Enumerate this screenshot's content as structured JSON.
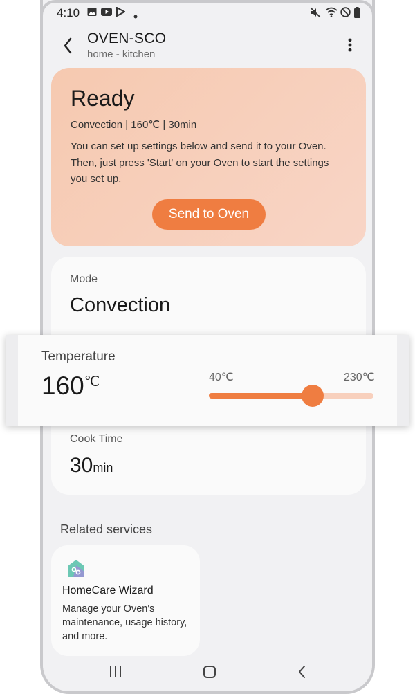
{
  "statusbar": {
    "time": "4:10",
    "left_icons": [
      "image-icon",
      "youtube-icon",
      "play-store-icon",
      "dot-icon"
    ],
    "right_icons": [
      "mute-icon",
      "wifi-icon",
      "do-not-disturb-icon",
      "battery-icon"
    ]
  },
  "header": {
    "title": "OVEN-SCO",
    "subtitle": "home - kitchen"
  },
  "status_card": {
    "title": "Ready",
    "summary": "Convection | 160℃ | 30min",
    "description": "You can set up settings below and send it to your Oven. Then, just press 'Start' on your Oven to start the settings you set up.",
    "send_button": "Send to Oven"
  },
  "settings": {
    "mode_label": "Mode",
    "mode_value": "Convection",
    "temperature_label": "Temperature",
    "temperature_value": "160",
    "temperature_unit": "℃",
    "temp_min": "40℃",
    "temp_max": "230℃",
    "temp_slider_fraction": 0.63,
    "cook_time_label": "Cook Time",
    "cook_time_value": "30",
    "cook_time_unit": "min"
  },
  "related": {
    "title": "Related services",
    "services": [
      {
        "name": "HomeCare Wizard",
        "description": "Manage your Oven's maintenance, usage history, and more.",
        "icon": "homecare-icon"
      }
    ]
  },
  "navbar": {
    "buttons": [
      "recent-apps-icon",
      "home-icon",
      "back-icon"
    ]
  },
  "colors": {
    "accent": "#ef7d41",
    "accent_light": "#f8d0bd",
    "card_gradient_start": "#f6c9b0",
    "card_gradient_end": "#f8d5c6",
    "homecare_teal": "#6cc8b4",
    "homecare_purple": "#9b8fd6"
  }
}
